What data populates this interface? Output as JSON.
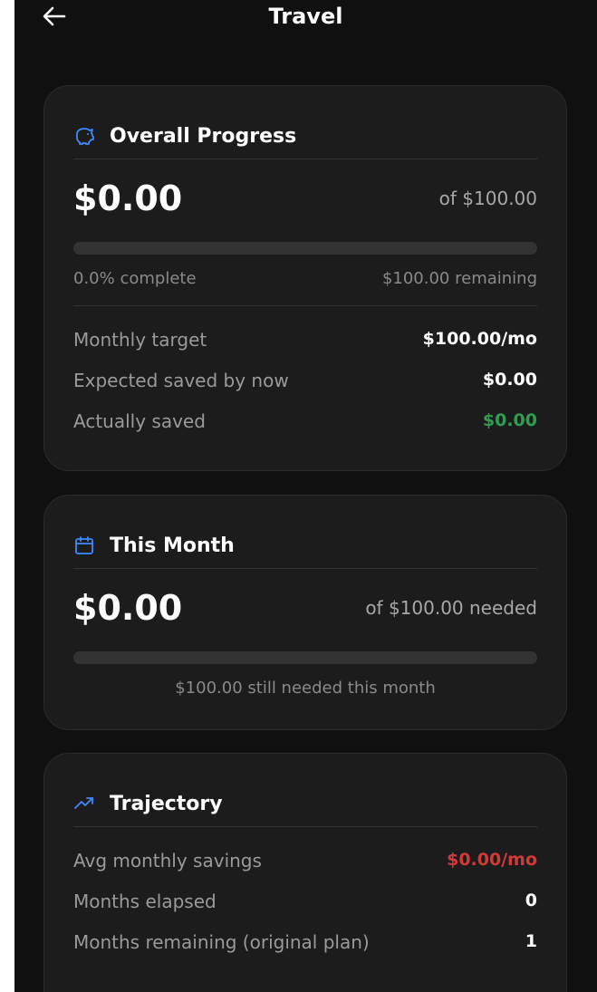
{
  "header": {
    "title": "Travel"
  },
  "overall": {
    "title": "Overall Progress",
    "icon": "piggy-bank-icon",
    "saved": "$0.00",
    "of_target": "of $100.00",
    "progress_fraction": 0.0,
    "complete_text": "0.0% complete",
    "remaining_text": "$100.00 remaining",
    "rows": [
      {
        "label": "Monthly target",
        "value": "$100.00/mo",
        "color": "#ffffff"
      },
      {
        "label": "Expected saved by now",
        "value": "$0.00",
        "color": "#ffffff"
      },
      {
        "label": "Actually saved",
        "value": "$0.00",
        "color": "#2e9e4f"
      }
    ]
  },
  "month": {
    "title": "This Month",
    "icon": "calendar-icon",
    "saved": "$0.00",
    "of_needed": "of $100.00 needed",
    "progress_fraction": 0.0,
    "still_needed_text": "$100.00 still needed this month"
  },
  "trajectory": {
    "title": "Trajectory",
    "icon": "trending-up-icon",
    "rows": [
      {
        "label": "Avg monthly savings",
        "value": "$0.00/mo",
        "color": "#d23a3a"
      },
      {
        "label": "Months elapsed",
        "value": "0",
        "color": "#ffffff"
      },
      {
        "label": "Months remaining (original plan)",
        "value": "1",
        "color": "#ffffff"
      }
    ]
  },
  "colors": {
    "accent": "#3d8bfd",
    "positive": "#2e9e4f",
    "negative": "#d23a3a"
  }
}
